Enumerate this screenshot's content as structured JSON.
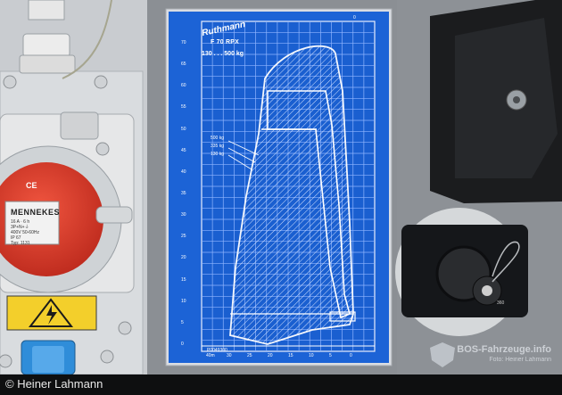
{
  "photo": {
    "caption": "© Heiner Lahmann",
    "watermark": "BOS-Fahrzeuge.info",
    "watermark_sub": "Foto: Heiner Lahmann"
  },
  "load_chart_panel": {
    "brand": "Ruthmann",
    "model": "F 70 RPX",
    "load_range": "130 . . . 500 kg",
    "load_labels": [
      "500 kg",
      "335 kg",
      "130 kg"
    ],
    "code": "P0049300",
    "grid_top_label": "0",
    "height_labels": [
      "70",
      "65",
      "60",
      "55",
      "50",
      "45",
      "40",
      "35",
      "30",
      "25",
      "20",
      "15",
      "10",
      "5",
      "0"
    ],
    "reach_labels": [
      "40m",
      "30",
      "25",
      "20",
      "15",
      "10",
      "5",
      "0"
    ],
    "colors": {
      "panel": "#1c63d6",
      "grid": "#9ec1ff",
      "border": "#e6e9ee"
    }
  },
  "socket": {
    "brand": "MENNEKES",
    "spec_lines": [
      "16 A · 6 h",
      "3P+N+⏚",
      "400V 50-60Hz",
      "IP 67"
    ],
    "type_label": "Typ: 1131",
    "mark": "CE",
    "colors": {
      "body": "#e23b2b",
      "cap": "#b7bcc0"
    }
  },
  "outlet": {
    "number": "360"
  }
}
